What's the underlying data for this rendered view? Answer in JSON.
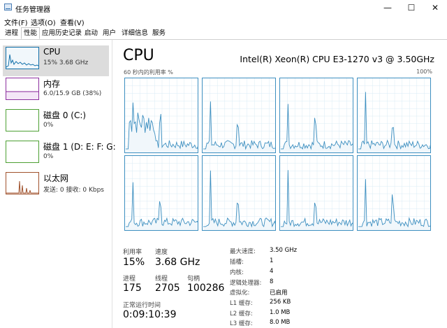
{
  "window": {
    "title": "任务管理器",
    "minimize": "—",
    "maximize": "☐",
    "close": "✕"
  },
  "menu": [
    "文件(F)",
    "选项(O)",
    "查看(V)"
  ],
  "tabs": [
    "进程",
    "性能",
    "应用历史记录",
    "启动",
    "用户",
    "详细信息",
    "服务"
  ],
  "active_tab": 1,
  "sidebar": [
    {
      "title": "CPU",
      "sub": "15% 3.68 GHz",
      "color": "#1170aa"
    },
    {
      "title": "内存",
      "sub": "6.0/15.9 GB (38%)",
      "color": "#8b2e9e"
    },
    {
      "title": "磁盘 0 (C:)",
      "sub": "0%",
      "color": "#4da033"
    },
    {
      "title": "磁盘 1 (D: E: F: G:",
      "sub": "0%",
      "color": "#4da033"
    },
    {
      "title": "以太网",
      "sub": "发送: 0 接收: 0 Kbps",
      "color": "#a0522d"
    }
  ],
  "main": {
    "title": "CPU",
    "model": "Intel(R) Xeon(R) CPU E3-1270 v3 @ 3.50GHz",
    "graph_label": "60 秒内的利用率 %",
    "graph_max": "100%",
    "graph_color": "#3d8fc0",
    "stats": {
      "util_label": "利用率",
      "util_value": "15%",
      "speed_label": "速度",
      "speed_value": "3.68 GHz",
      "proc_label": "进程",
      "proc_value": "175",
      "thread_label": "线程",
      "thread_value": "2705",
      "handle_label": "句柄",
      "handle_value": "100286",
      "uptime_label": "正常运行时间",
      "uptime_value": "0:09:10:39"
    },
    "specs": [
      {
        "label": "最大速度:",
        "value": "3.50 GHz"
      },
      {
        "label": "插槽:",
        "value": "1"
      },
      {
        "label": "内核:",
        "value": "4"
      },
      {
        "label": "逻辑处理器:",
        "value": "8"
      },
      {
        "label": "虚拟化:",
        "value": "已启用"
      },
      {
        "label": "L1 缓存:",
        "value": "256 KB"
      },
      {
        "label": "L2 缓存:",
        "value": "1.0 MB"
      },
      {
        "label": "L3 缓存:",
        "value": "8.0 MB"
      }
    ]
  }
}
